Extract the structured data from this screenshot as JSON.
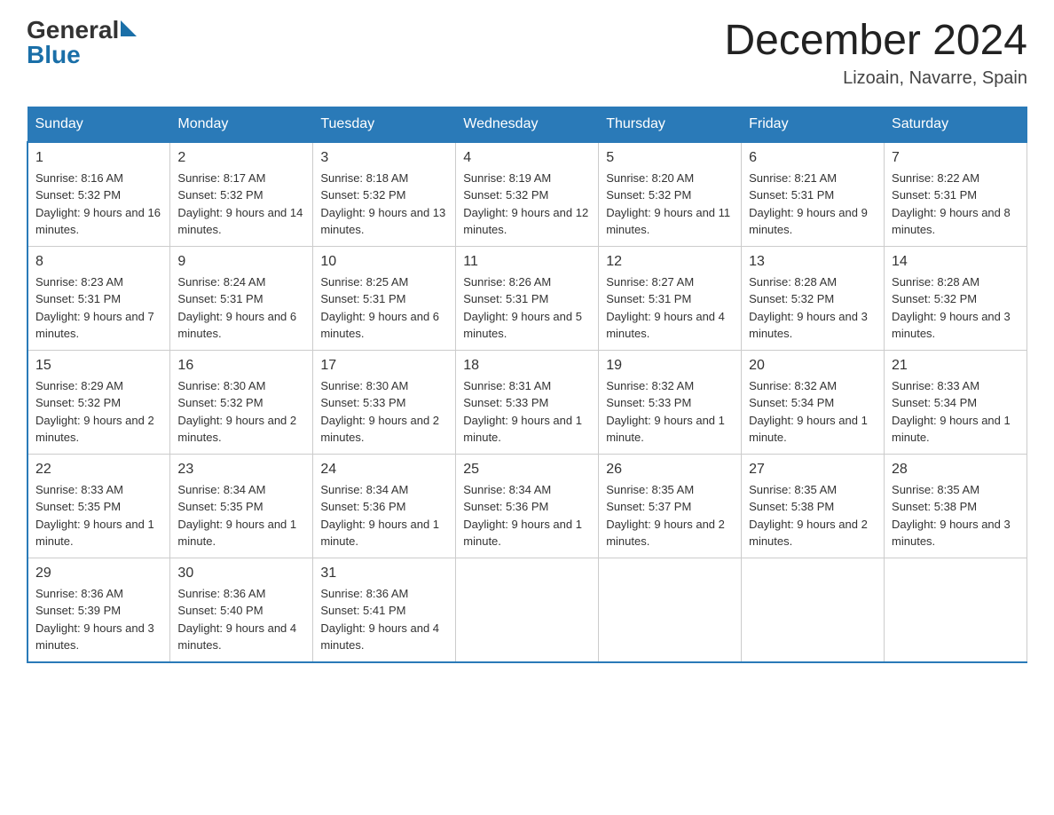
{
  "header": {
    "logo_general": "General",
    "logo_blue": "Blue",
    "month_title": "December 2024",
    "location": "Lizoain, Navarre, Spain"
  },
  "weekdays": [
    "Sunday",
    "Monday",
    "Tuesday",
    "Wednesday",
    "Thursday",
    "Friday",
    "Saturday"
  ],
  "weeks": [
    [
      {
        "day": "1",
        "sunrise": "8:16 AM",
        "sunset": "5:32 PM",
        "daylight": "9 hours and 16 minutes."
      },
      {
        "day": "2",
        "sunrise": "8:17 AM",
        "sunset": "5:32 PM",
        "daylight": "9 hours and 14 minutes."
      },
      {
        "day": "3",
        "sunrise": "8:18 AM",
        "sunset": "5:32 PM",
        "daylight": "9 hours and 13 minutes."
      },
      {
        "day": "4",
        "sunrise": "8:19 AM",
        "sunset": "5:32 PM",
        "daylight": "9 hours and 12 minutes."
      },
      {
        "day": "5",
        "sunrise": "8:20 AM",
        "sunset": "5:32 PM",
        "daylight": "9 hours and 11 minutes."
      },
      {
        "day": "6",
        "sunrise": "8:21 AM",
        "sunset": "5:31 PM",
        "daylight": "9 hours and 9 minutes."
      },
      {
        "day": "7",
        "sunrise": "8:22 AM",
        "sunset": "5:31 PM",
        "daylight": "9 hours and 8 minutes."
      }
    ],
    [
      {
        "day": "8",
        "sunrise": "8:23 AM",
        "sunset": "5:31 PM",
        "daylight": "9 hours and 7 minutes."
      },
      {
        "day": "9",
        "sunrise": "8:24 AM",
        "sunset": "5:31 PM",
        "daylight": "9 hours and 6 minutes."
      },
      {
        "day": "10",
        "sunrise": "8:25 AM",
        "sunset": "5:31 PM",
        "daylight": "9 hours and 6 minutes."
      },
      {
        "day": "11",
        "sunrise": "8:26 AM",
        "sunset": "5:31 PM",
        "daylight": "9 hours and 5 minutes."
      },
      {
        "day": "12",
        "sunrise": "8:27 AM",
        "sunset": "5:31 PM",
        "daylight": "9 hours and 4 minutes."
      },
      {
        "day": "13",
        "sunrise": "8:28 AM",
        "sunset": "5:32 PM",
        "daylight": "9 hours and 3 minutes."
      },
      {
        "day": "14",
        "sunrise": "8:28 AM",
        "sunset": "5:32 PM",
        "daylight": "9 hours and 3 minutes."
      }
    ],
    [
      {
        "day": "15",
        "sunrise": "8:29 AM",
        "sunset": "5:32 PM",
        "daylight": "9 hours and 2 minutes."
      },
      {
        "day": "16",
        "sunrise": "8:30 AM",
        "sunset": "5:32 PM",
        "daylight": "9 hours and 2 minutes."
      },
      {
        "day": "17",
        "sunrise": "8:30 AM",
        "sunset": "5:33 PM",
        "daylight": "9 hours and 2 minutes."
      },
      {
        "day": "18",
        "sunrise": "8:31 AM",
        "sunset": "5:33 PM",
        "daylight": "9 hours and 1 minute."
      },
      {
        "day": "19",
        "sunrise": "8:32 AM",
        "sunset": "5:33 PM",
        "daylight": "9 hours and 1 minute."
      },
      {
        "day": "20",
        "sunrise": "8:32 AM",
        "sunset": "5:34 PM",
        "daylight": "9 hours and 1 minute."
      },
      {
        "day": "21",
        "sunrise": "8:33 AM",
        "sunset": "5:34 PM",
        "daylight": "9 hours and 1 minute."
      }
    ],
    [
      {
        "day": "22",
        "sunrise": "8:33 AM",
        "sunset": "5:35 PM",
        "daylight": "9 hours and 1 minute."
      },
      {
        "day": "23",
        "sunrise": "8:34 AM",
        "sunset": "5:35 PM",
        "daylight": "9 hours and 1 minute."
      },
      {
        "day": "24",
        "sunrise": "8:34 AM",
        "sunset": "5:36 PM",
        "daylight": "9 hours and 1 minute."
      },
      {
        "day": "25",
        "sunrise": "8:34 AM",
        "sunset": "5:36 PM",
        "daylight": "9 hours and 1 minute."
      },
      {
        "day": "26",
        "sunrise": "8:35 AM",
        "sunset": "5:37 PM",
        "daylight": "9 hours and 2 minutes."
      },
      {
        "day": "27",
        "sunrise": "8:35 AM",
        "sunset": "5:38 PM",
        "daylight": "9 hours and 2 minutes."
      },
      {
        "day": "28",
        "sunrise": "8:35 AM",
        "sunset": "5:38 PM",
        "daylight": "9 hours and 3 minutes."
      }
    ],
    [
      {
        "day": "29",
        "sunrise": "8:36 AM",
        "sunset": "5:39 PM",
        "daylight": "9 hours and 3 minutes."
      },
      {
        "day": "30",
        "sunrise": "8:36 AM",
        "sunset": "5:40 PM",
        "daylight": "9 hours and 4 minutes."
      },
      {
        "day": "31",
        "sunrise": "8:36 AM",
        "sunset": "5:41 PM",
        "daylight": "9 hours and 4 minutes."
      },
      null,
      null,
      null,
      null
    ]
  ]
}
